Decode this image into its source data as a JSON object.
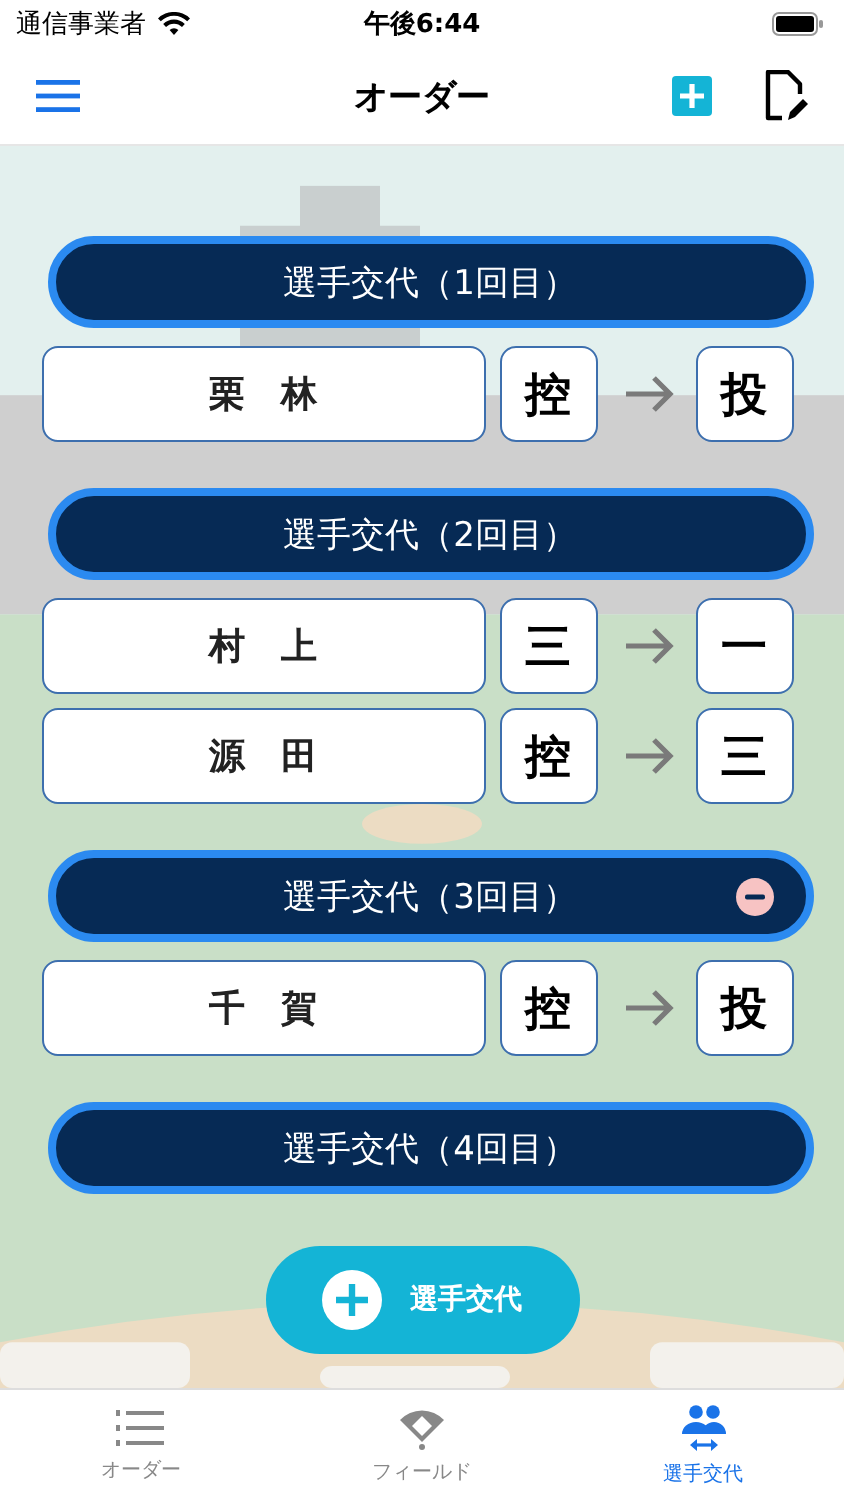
{
  "status_bar": {
    "carrier": "通信事業者",
    "time": "午後6:44"
  },
  "nav": {
    "title": "オーダー"
  },
  "substitutions": [
    {
      "title": "選手交代（1回目）",
      "removable": false,
      "players": [
        {
          "name": "栗　林",
          "from": "控",
          "to": "投"
        }
      ]
    },
    {
      "title": "選手交代（2回目）",
      "removable": false,
      "players": [
        {
          "name": "村　上",
          "from": "三",
          "to": "一"
        },
        {
          "name": "源　田",
          "from": "控",
          "to": "三"
        }
      ]
    },
    {
      "title": "選手交代（3回目）",
      "removable": true,
      "players": [
        {
          "name": "千　賀",
          "from": "控",
          "to": "投"
        }
      ]
    },
    {
      "title": "選手交代（4回目）",
      "removable": false
    }
  ],
  "add_button": {
    "label": "選手交代"
  },
  "tabs": [
    {
      "kind": "order",
      "label": "オーダー",
      "selected": false
    },
    {
      "kind": "field",
      "label": "フィールド",
      "selected": false
    },
    {
      "kind": "swap",
      "label": "選手交代",
      "selected": true
    }
  ]
}
